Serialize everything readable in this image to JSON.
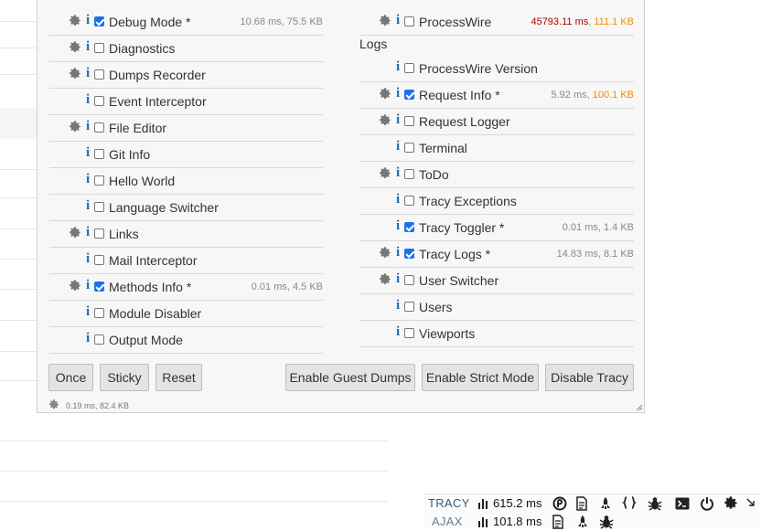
{
  "left_column": [
    {
      "label": "Debug Mode *",
      "gear": true,
      "checked": true,
      "stat": "10.68 ms, 75.5 KB"
    },
    {
      "label": "Diagnostics",
      "gear": true,
      "checked": false
    },
    {
      "label": "Dumps Recorder",
      "gear": true,
      "checked": false
    },
    {
      "label": "Event Interceptor",
      "gear": false,
      "checked": false
    },
    {
      "label": "File Editor",
      "gear": true,
      "checked": false
    },
    {
      "label": "Git Info",
      "gear": false,
      "checked": false
    },
    {
      "label": "Hello World",
      "gear": false,
      "checked": false
    },
    {
      "label": "Language Switcher",
      "gear": false,
      "checked": false
    },
    {
      "label": "Links",
      "gear": true,
      "checked": false
    },
    {
      "label": "Mail Interceptor",
      "gear": false,
      "checked": false
    },
    {
      "label": "Methods Info *",
      "gear": true,
      "checked": true,
      "stat": "0.01 ms, 4.5 KB"
    },
    {
      "label": "Module Disabler",
      "gear": false,
      "checked": false
    },
    {
      "label": "Output Mode",
      "gear": false,
      "checked": false
    }
  ],
  "right_column": [
    {
      "label": "ProcessWire",
      "gear": true,
      "checked": false,
      "stat_red": "45793.11 ms",
      "stat_sep": ", ",
      "stat_orange": "111.1 KB"
    },
    {
      "label": "ProcessWire Version",
      "gear": false,
      "checked": false
    },
    {
      "label": "Request Info *",
      "gear": true,
      "checked": true,
      "stat": "5.92 ms, ",
      "stat_orange": "100.1 KB"
    },
    {
      "label": "Request Logger",
      "gear": true,
      "checked": false
    },
    {
      "label": "Terminal",
      "gear": false,
      "checked": false
    },
    {
      "label": "ToDo",
      "gear": true,
      "checked": false
    },
    {
      "label": "Tracy Exceptions",
      "gear": false,
      "checked": false
    },
    {
      "label": "Tracy Toggler *",
      "gear": false,
      "checked": true,
      "stat": "0.01 ms, 1.4 KB"
    },
    {
      "label": "Tracy Logs *",
      "gear": true,
      "checked": true,
      "stat": "14.83 ms, 8.1 KB"
    },
    {
      "label": "User Switcher",
      "gear": true,
      "checked": false
    },
    {
      "label": "Users",
      "gear": false,
      "checked": false
    },
    {
      "label": "Viewports",
      "gear": false,
      "checked": false
    }
  ],
  "logs_label": "Logs",
  "buttons": {
    "once": "Once",
    "sticky": "Sticky",
    "reset": "Reset",
    "guest_dumps": "Enable Guest Dumps",
    "strict_mode": "Enable Strict Mode",
    "disable": "Disable Tracy"
  },
  "panel_stat": "0.19 ms, 82.4 KB",
  "info_glyph": "i",
  "tracy_bar": {
    "brand": "TRACY",
    "time": "615.2 ms",
    "ajax_brand": "AJAX",
    "ajax_time": "101.8 ms"
  },
  "colors": {
    "info_icon": "#1d6cb8",
    "checkbox_checked": "#1a73e8",
    "stat_red": "#b00000",
    "stat_orange": "#f08c00"
  }
}
